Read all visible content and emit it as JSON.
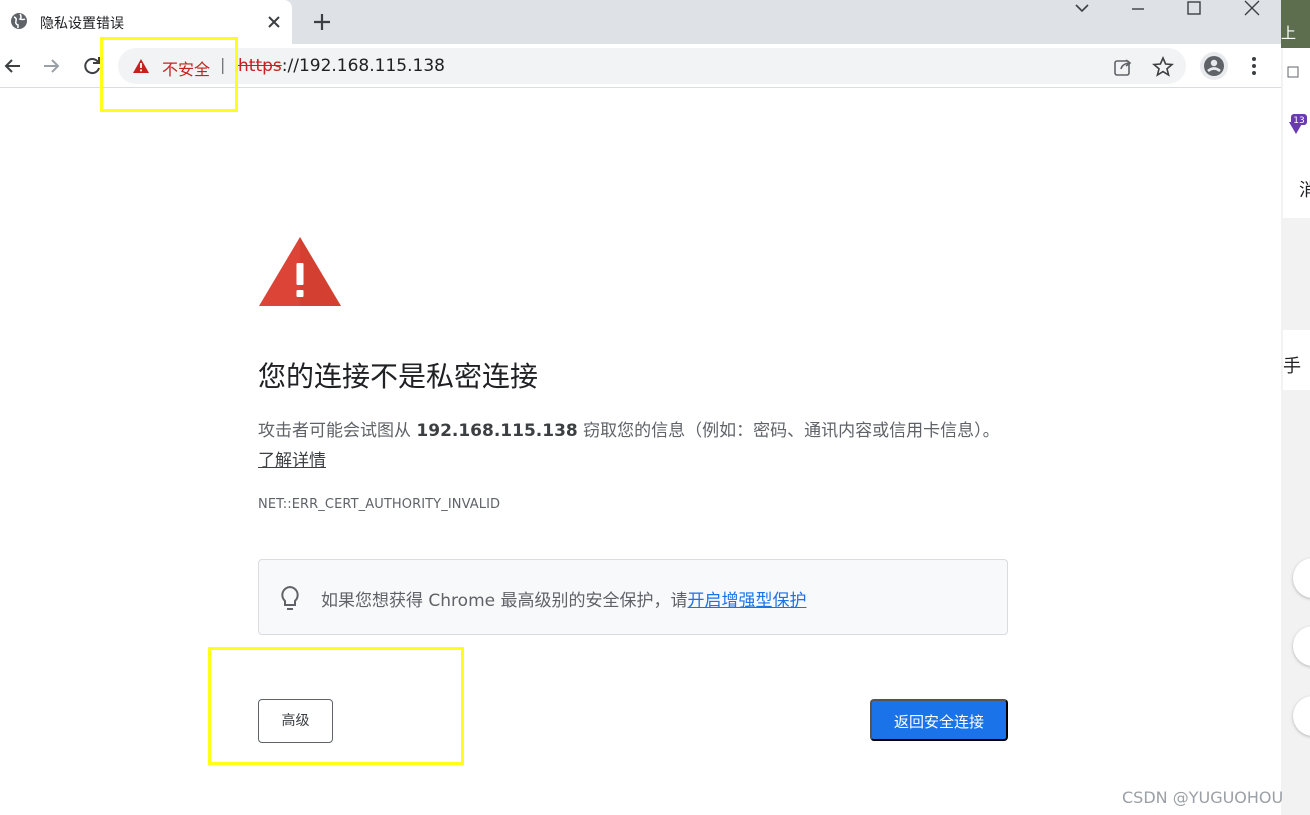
{
  "tab": {
    "title": "隐私设置错误",
    "favicon": "globe-icon",
    "close_icon": "close-icon"
  },
  "new_tab_icon": "plus-icon",
  "window_controls": [
    "chevron-down-icon",
    "minimize-icon",
    "maximize-icon",
    "close-icon"
  ],
  "nav": {
    "back_icon": "back-arrow-icon",
    "forward_icon": "forward-arrow-icon",
    "reload_icon": "reload-icon"
  },
  "omnibox": {
    "security_label": "不安全",
    "separator": "|",
    "url_scheme": "https",
    "url_rest": "://192.168.115.138",
    "share_icon": "share-icon",
    "bookmark_icon": "star-icon",
    "warning_color": "#c5221f"
  },
  "profile_icon": "person-icon",
  "menu_icon": "more-vert-icon",
  "interstitial": {
    "warning_icon": "warning-triangle-icon",
    "warning_color": "#db4437",
    "heading": "您的连接不是私密连接",
    "desc_prefix": "攻击者可能会试图从 ",
    "desc_host": "192.168.115.138",
    "desc_suffix": " 窃取您的信息（例如：密码、通讯内容或信用卡信息）。",
    "learn_more": "了解详情",
    "error_code": "NET::ERR_CERT_AUTHORITY_INVALID",
    "tip_icon": "lightbulb-icon",
    "tip_text": "如果您想获得 Chrome 最高级别的安全保护，请",
    "tip_link": "开启增强型保护",
    "advanced_button": "高级",
    "back_button": "返回安全连接",
    "accent_color": "#1a73e8"
  },
  "side_app": {
    "char_top": "上",
    "badge_count": "13",
    "char_1": "消",
    "char_2": "手"
  },
  "watermark": "CSDN @YUGUOHOU"
}
